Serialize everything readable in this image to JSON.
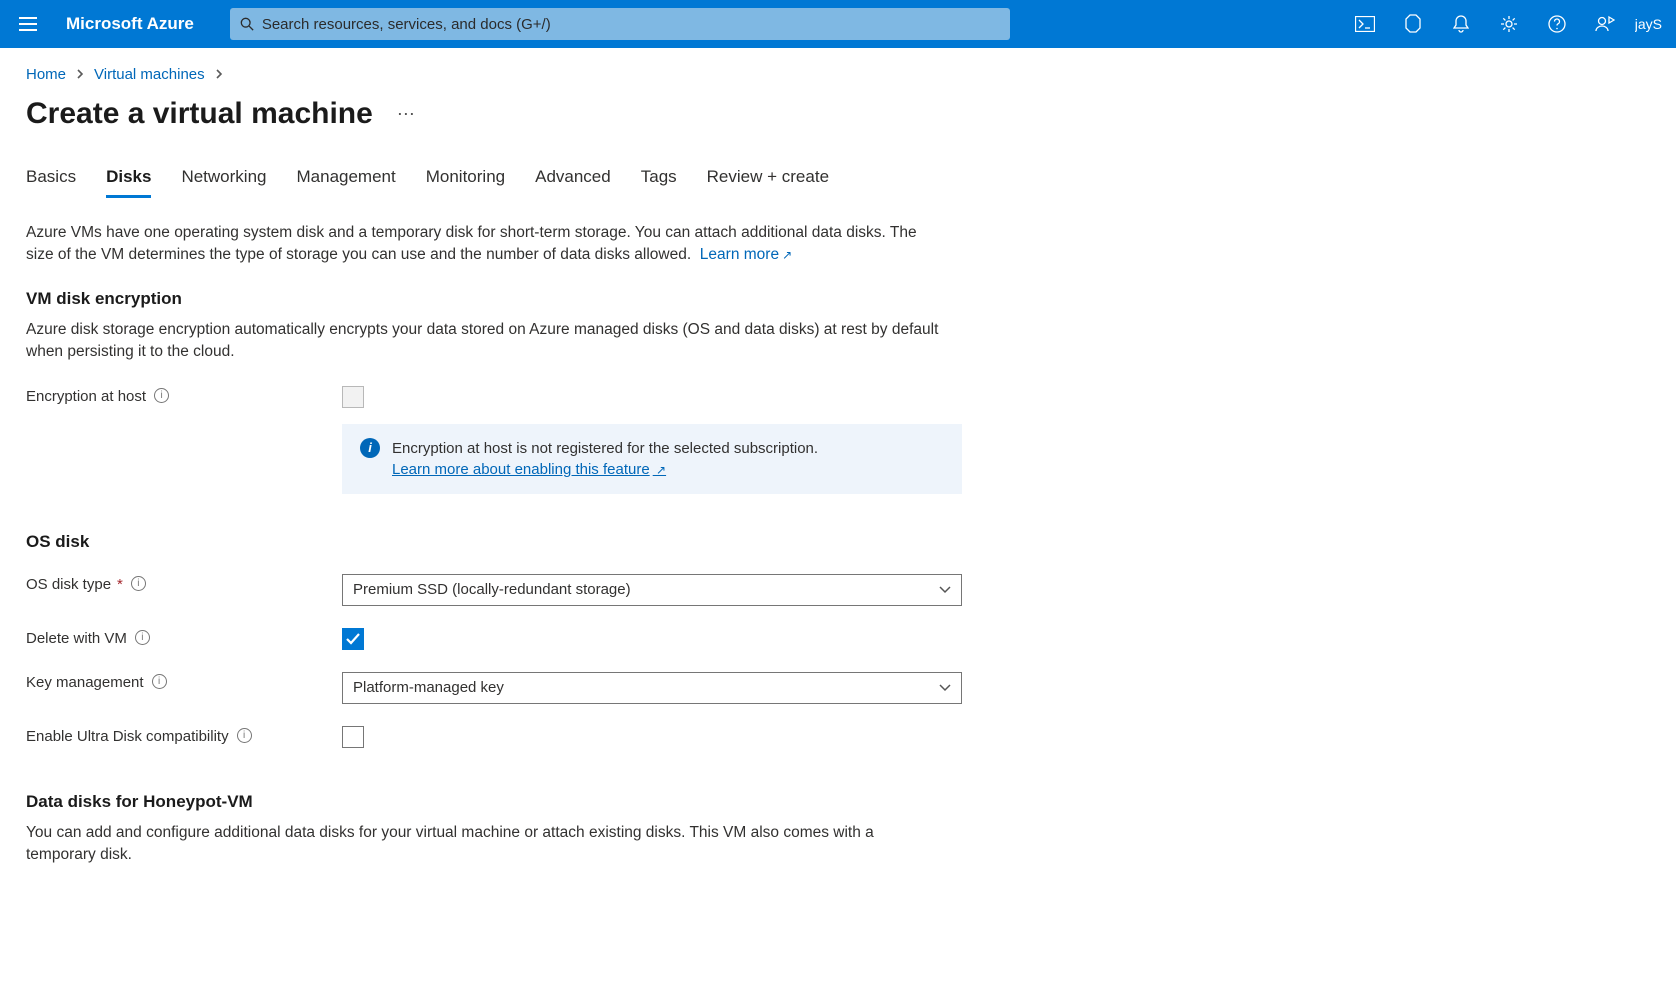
{
  "header": {
    "brand": "Microsoft Azure",
    "search_placeholder": "Search resources, services, and docs (G+/)",
    "user_label": "jayS"
  },
  "breadcrumb": {
    "home": "Home",
    "vms": "Virtual machines"
  },
  "page_title": "Create a virtual machine",
  "tabs": {
    "basics": "Basics",
    "disks": "Disks",
    "networking": "Networking",
    "management": "Management",
    "monitoring": "Monitoring",
    "advanced": "Advanced",
    "tags": "Tags",
    "review": "Review + create"
  },
  "intro": {
    "text": "Azure VMs have one operating system disk and a temporary disk for short-term storage. You can attach additional data disks. The size of the VM determines the type of storage you can use and the number of data disks allowed.",
    "learn_more": "Learn more"
  },
  "section_encryption": {
    "title": "VM disk encryption",
    "desc": "Azure disk storage encryption automatically encrypts your data stored on Azure managed disks (OS and data disks) at rest by default when persisting it to the cloud.",
    "enc_at_host_label": "Encryption at host",
    "info_text": "Encryption at host is not registered for the selected subscription.",
    "info_link": "Learn more about enabling this feature"
  },
  "section_osdisk": {
    "title": "OS disk",
    "os_disk_type_label": "OS disk type",
    "os_disk_type_value": "Premium SSD (locally-redundant storage)",
    "delete_with_vm_label": "Delete with VM",
    "key_mgmt_label": "Key management",
    "key_mgmt_value": "Platform-managed key",
    "ultra_label": "Enable Ultra Disk compatibility"
  },
  "section_datadisks": {
    "title": "Data disks for Honeypot-VM",
    "desc": "You can add and configure additional data disks for your virtual machine or attach existing disks. This VM also comes with a temporary disk."
  }
}
